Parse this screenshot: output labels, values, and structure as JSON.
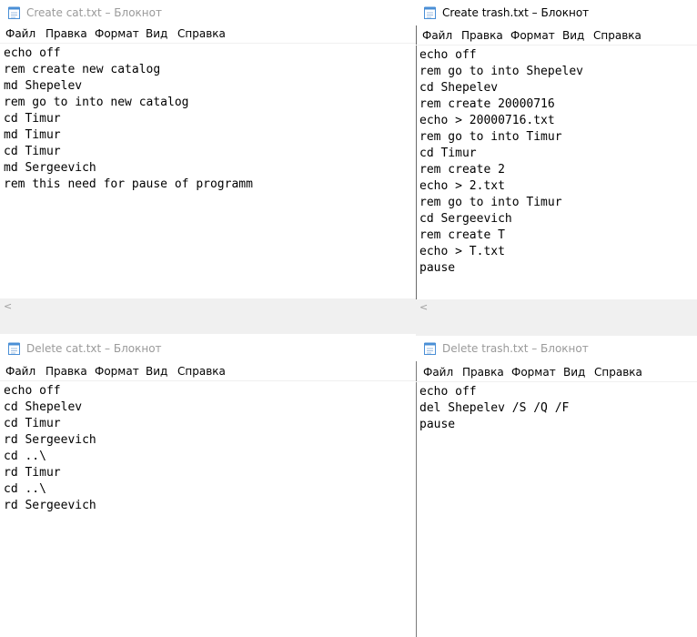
{
  "menu": [
    "Файл",
    "Правка",
    "Формат",
    "Вид",
    "Справка"
  ],
  "windows": {
    "create_cat": {
      "title": "Create cat.txt – Блокнот",
      "lines": [
        "echo off",
        "rem create new catalog",
        "md Shepelev",
        "rem go to into new catalog",
        "cd Timur",
        "md Timur",
        "cd Timur",
        "md Sergeevich",
        "rem this need for pause of programm"
      ],
      "scroll_arrow": "<"
    },
    "create_trash": {
      "title": "Create trash.txt – Блокнот",
      "lines": [
        "echo off",
        "rem go to into Shepelev",
        "cd Shepelev",
        "rem create 20000716",
        "echo > 20000716.txt",
        "rem go to into Timur",
        "cd Timur",
        "rem create 2",
        "echo > 2.txt",
        "rem go to into Timur",
        "cd Sergeevich",
        "rem create T",
        "echo > T.txt",
        "pause"
      ],
      "scroll_arrow": "<"
    },
    "delete_cat": {
      "title": "Delete cat.txt – Блокнот",
      "lines": [
        "echo off",
        "cd Shepelev",
        "cd Timur",
        "rd Sergeevich",
        "cd ..\\",
        "rd Timur",
        "cd ..\\",
        "rd Sergeevich"
      ]
    },
    "delete_trash": {
      "title": "Delete trash.txt – Блокнот",
      "lines": [
        "echo off",
        "del Shepelev /S /Q /F",
        "pause"
      ]
    }
  },
  "colors": {
    "inactive_title": "#9a9a9a",
    "scrollbar": "#f0f0f0",
    "notepad_icon": "#4a8fd6"
  },
  "icons": {
    "app": "notepad-icon"
  }
}
